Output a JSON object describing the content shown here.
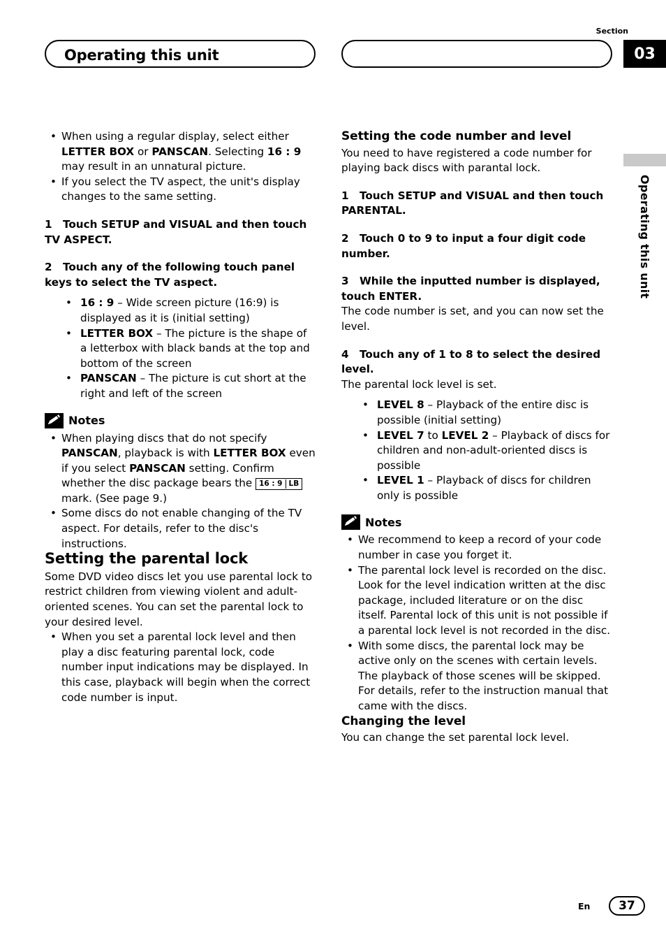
{
  "header": {
    "title": "Operating this unit",
    "section_label": "Section",
    "section_number": "03",
    "side_tab_text": "Operating this unit"
  },
  "left_column": {
    "intro_bullets": [
      "When using a regular display, select either LETTER BOX or PANSCAN. Selecting 16 : 9 may result in an unnatural picture.",
      "If you select the TV aspect, the unit's display changes to the same setting."
    ],
    "step1": {
      "num": "1",
      "text": "Touch SETUP and VISUAL and then touch TV ASPECT."
    },
    "step2": {
      "num": "2",
      "text": "Touch any of the following touch panel keys to select the TV aspect."
    },
    "aspect_items": [
      {
        "term": "16 : 9",
        "desc": "– Wide screen picture (16:9) is displayed as it is (initial setting)"
      },
      {
        "term": "LETTER BOX",
        "desc": "– The picture is the shape of a letterbox with black bands at the top and bottom of the screen"
      },
      {
        "term": "PANSCAN",
        "desc": "– The picture is cut short at the right and left of the screen"
      }
    ],
    "notes_label": "Notes",
    "notes": [
      "When playing discs that do not specify PANSCAN, playback is with LETTER BOX even if you select PANSCAN setting. Confirm whether the disc package bears the 16 : 9 LB mark. (See page 9.)",
      "Some discs do not enable changing of the TV aspect. For details, refer to the disc's instructions."
    ],
    "mark_16_9": "16 : 9",
    "mark_lb": "LB",
    "parental_heading": "Setting the parental lock",
    "parental_body": "Some DVD video discs let you use parental lock to restrict children from viewing violent and adult-oriented scenes. You can set the parental lock to your desired level.",
    "parental_bullet": "When you set a parental lock level and then play a disc featuring parental lock, code number input indications may be displayed. In this case, playback will begin when the correct code number is input."
  },
  "right_column": {
    "code_heading": "Setting the code number and level",
    "code_body": "You need to have registered a code number for playing back discs with parantal lock.",
    "step1": {
      "num": "1",
      "text": "Touch SETUP and VISUAL and then touch PARENTAL."
    },
    "step2": {
      "num": "2",
      "text": "Touch 0 to 9 to input a four digit code number."
    },
    "step3": {
      "num": "3",
      "text": "While the inputted number is displayed, touch ENTER."
    },
    "step3_body": "The code number is set, and you can now set the level.",
    "step4": {
      "num": "4",
      "text": "Touch any of 1 to 8 to select the desired level."
    },
    "step4_body": "The parental lock level is set.",
    "level_items": [
      {
        "term": "LEVEL 8",
        "desc": "– Playback of the entire disc is possible (initial setting)"
      },
      {
        "term": "LEVEL 7",
        "term2": "LEVEL 2",
        "joiner": "to",
        "desc": "– Playback of discs for children and non-adult-oriented discs is possible"
      },
      {
        "term": "LEVEL 1",
        "desc": "– Playback of discs for children only is possible"
      }
    ],
    "notes_label": "Notes",
    "notes": [
      "We recommend to keep a record of your code number in case you forget it.",
      "The parental lock level is recorded on the disc. Look for the level indication written at the disc package, included literature or on the disc itself. Parental lock of this unit is not possible if a parental lock level is not recorded in the disc.",
      "With some discs, the parental lock may be active only on the scenes with certain levels. The playback of those scenes will be skipped. For details, refer to the instruction manual that came with the discs."
    ],
    "changing_heading": "Changing the level",
    "changing_body": "You can change the set parental lock level."
  },
  "footer": {
    "lang": "En",
    "page": "37"
  }
}
